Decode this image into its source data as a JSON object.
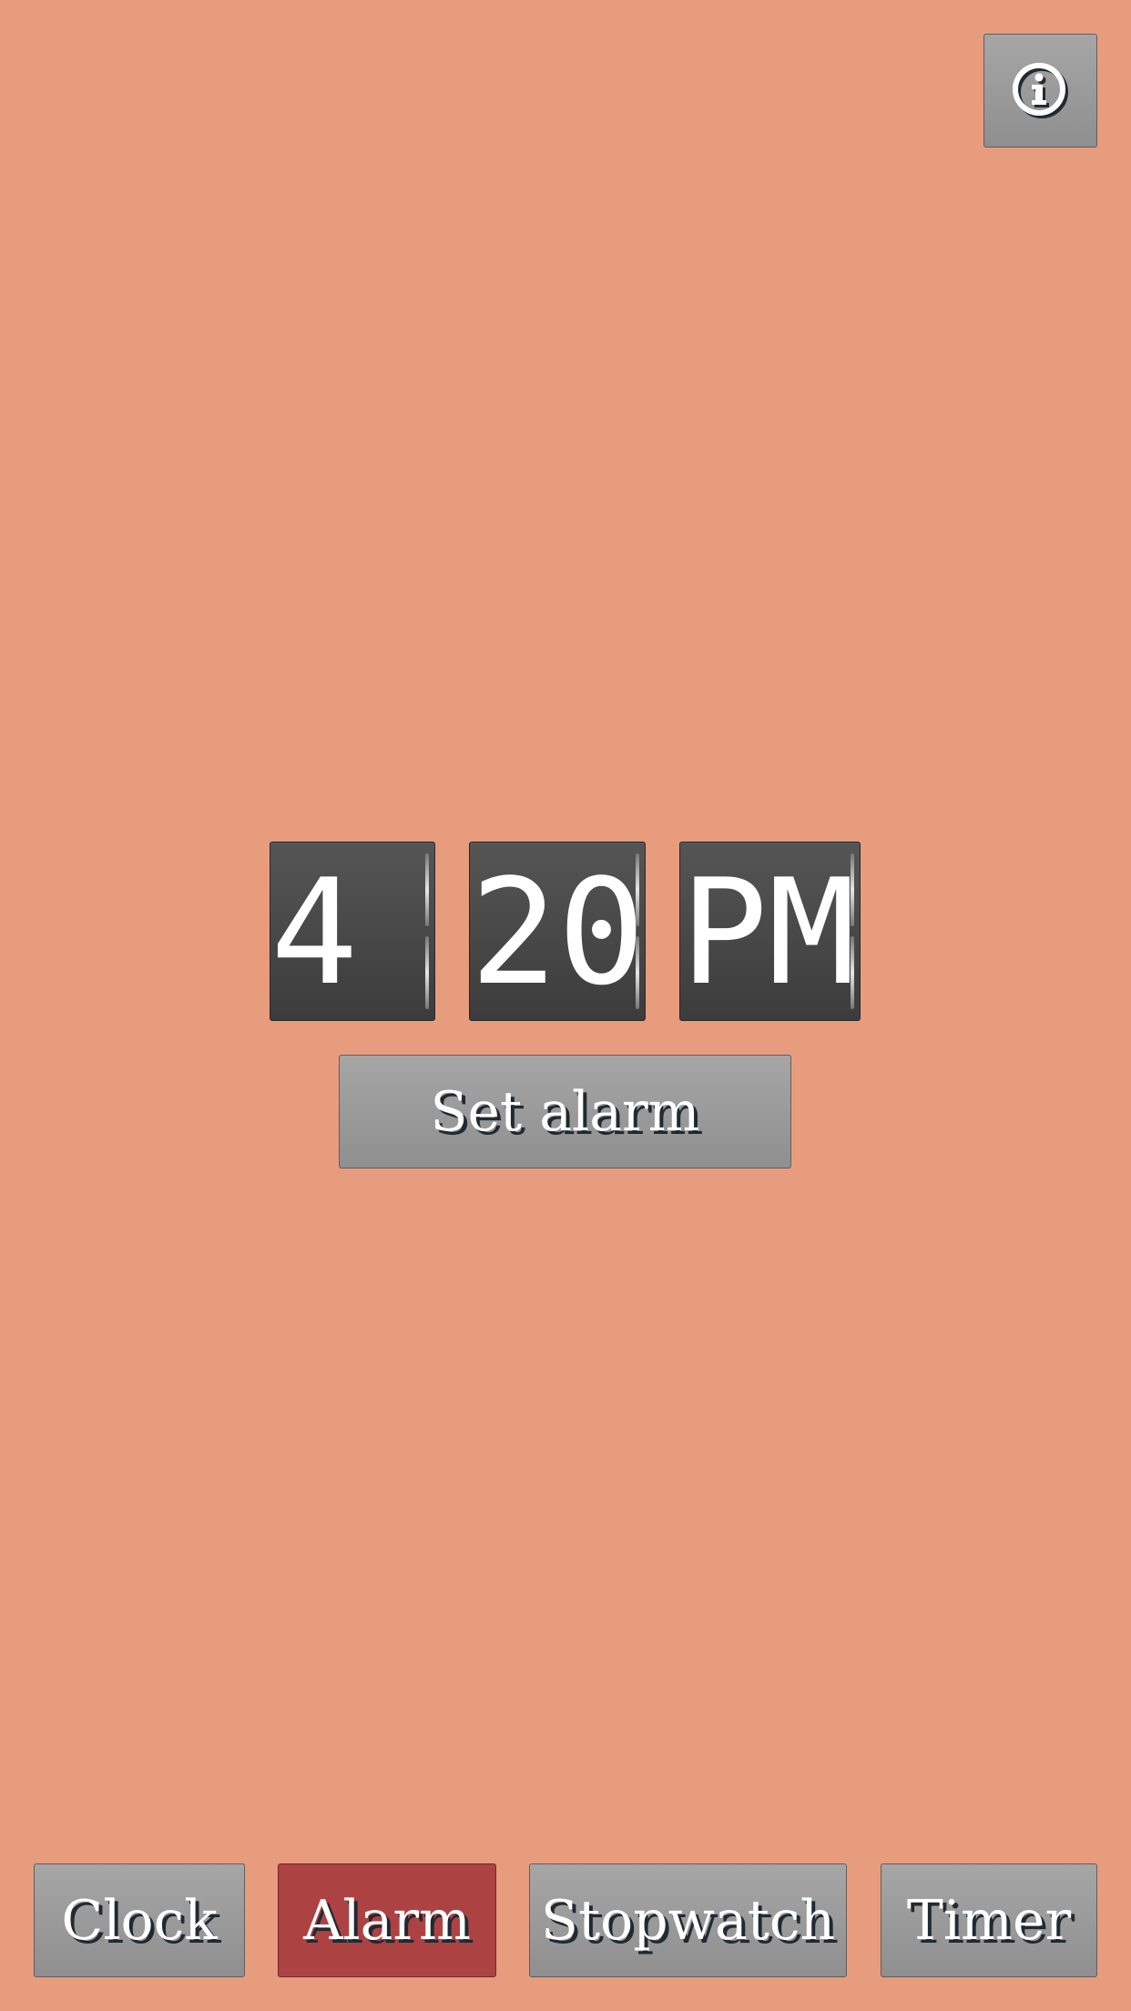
{
  "colors": {
    "background": "#e89c7e",
    "button": "#9a9a9a",
    "active_tab": "#ad4243",
    "flip_card": "#4a4a4a",
    "text": "#ffffff",
    "text_shadow": "#1f2a33"
  },
  "header": {
    "info_icon": "info-icon"
  },
  "alarm_time": {
    "hour": "4",
    "minute": "20",
    "period": "PM"
  },
  "set_alarm_label": "Set alarm",
  "nav": {
    "items": [
      {
        "label": "Clock",
        "active": false
      },
      {
        "label": "Alarm",
        "active": true
      },
      {
        "label": "Stopwatch",
        "active": false
      },
      {
        "label": "Timer",
        "active": false
      }
    ]
  }
}
